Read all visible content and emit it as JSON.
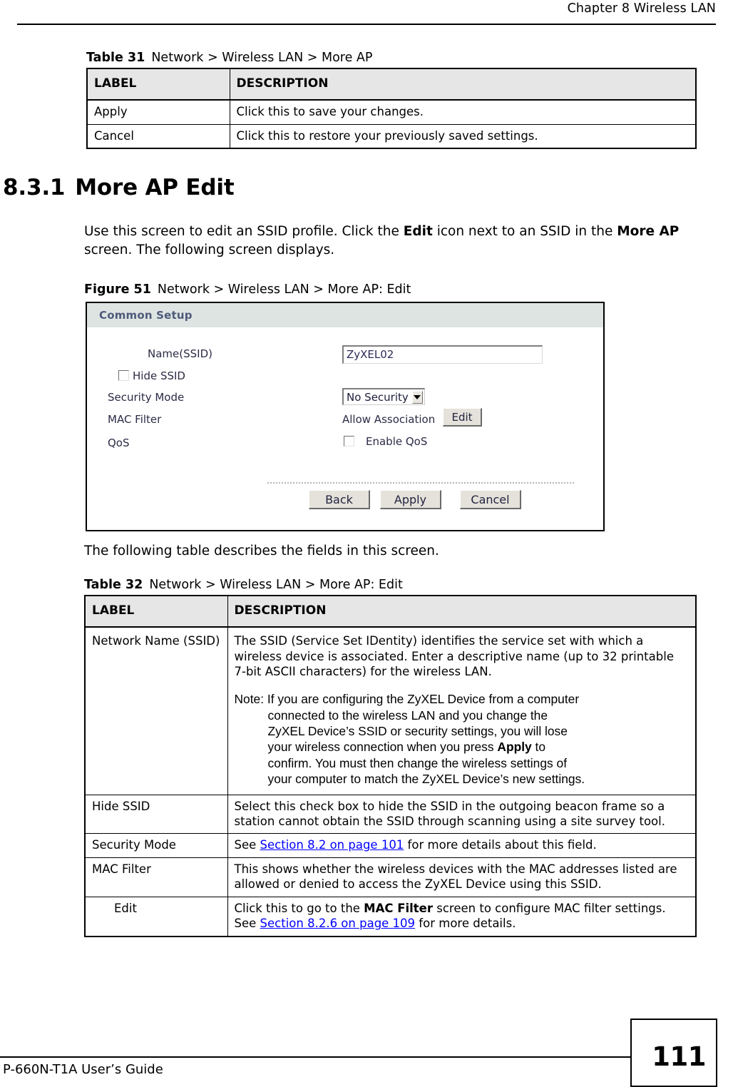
{
  "page": {
    "running_head": "Chapter 8 Wireless LAN",
    "footer_guide": "P-660N-T1A User’s Guide",
    "page_number": "111"
  },
  "table31": {
    "caption_number": "Table 31",
    "caption_text": "Network > Wireless LAN > More AP",
    "headers": [
      "LABEL",
      "DESCRIPTION"
    ],
    "rows": [
      {
        "label": "Apply",
        "description": "Click this to save your changes."
      },
      {
        "label": "Cancel",
        "description": "Click this to restore your previously saved settings."
      }
    ]
  },
  "section": {
    "number": "8.3.1",
    "title": "More AP Edit",
    "intro_part1": "Use this screen to edit an SSID profile. Click the ",
    "intro_bold1": "Edit",
    "intro_part2": " icon next to an SSID in the ",
    "intro_bold2": "More AP",
    "intro_part3": " screen. The following screen displays."
  },
  "figure51": {
    "caption_number": "Figure 51",
    "caption_text": "Network > Wireless LAN > More AP: Edit",
    "panel_title": "Common Setup",
    "fields": {
      "name_ssid_label": "Name(SSID)",
      "name_ssid_value": "ZyXEL02",
      "hide_ssid_label": "Hide SSID",
      "hide_ssid_checked": false,
      "security_mode_label": "Security Mode",
      "security_mode_value": "No Security",
      "mac_filter_label": "MAC Filter",
      "mac_filter_value": "Allow Association",
      "mac_filter_edit_button": "Edit",
      "qos_label": "QoS",
      "qos_enable_label": "Enable QoS",
      "qos_checked": false
    },
    "buttons": [
      "Back",
      "Apply",
      "Cancel"
    ]
  },
  "after_figure_text": "The following table describes the fields in this screen.",
  "table32": {
    "caption_number": "Table 32",
    "caption_text": "Network > Wireless LAN > More AP: Edit",
    "headers": [
      "LABEL",
      "DESCRIPTION"
    ],
    "rows": {
      "network_name": {
        "label": "Network Name (SSID)",
        "desc_para": "The SSID (Service Set IDentity) identifies the service set with which a wireless device is associated. Enter a descriptive name (up to 32 printable 7-bit ASCII characters) for the wireless LAN.",
        "note_lines": [
          "Note: If you are configuring the ZyXEL Device from a computer",
          "connected to the wireless LAN and you change the",
          "ZyXEL Device’s SSID or security settings, you will lose",
          "your wireless connection when you press ",
          "confirm. You must then change the wireless settings of",
          "your computer to match the ZyXEL Device’s new settings."
        ],
        "note_bold": "Apply",
        "note_after_bold": " to"
      },
      "hide_ssid": {
        "label": "Hide SSID",
        "desc": "Select this check box to hide the SSID in the outgoing beacon frame so a station cannot obtain the SSID through scanning using a site survey tool."
      },
      "security_mode": {
        "label": "Security Mode",
        "desc_before": "See ",
        "link": "Section 8.2 on page 101",
        "desc_after": " for more details about this field."
      },
      "mac_filter": {
        "label": "MAC Filter",
        "desc": "This shows whether the wireless devices with the MAC addresses listed are allowed or denied to access the ZyXEL Device using this SSID."
      },
      "edit": {
        "label": "Edit",
        "desc_before": "Click this to go to the ",
        "bold": "MAC Filter",
        "desc_middle": " screen to configure MAC filter settings. See ",
        "link": "Section 8.2.6 on page 109",
        "desc_after": " for more details."
      }
    }
  },
  "colors": {
    "link": "#0000ff",
    "table_header_bg": "#e6e6e6",
    "panel_header_bg": "#dde4e2",
    "panel_header_text": "#4e5a7a"
  }
}
